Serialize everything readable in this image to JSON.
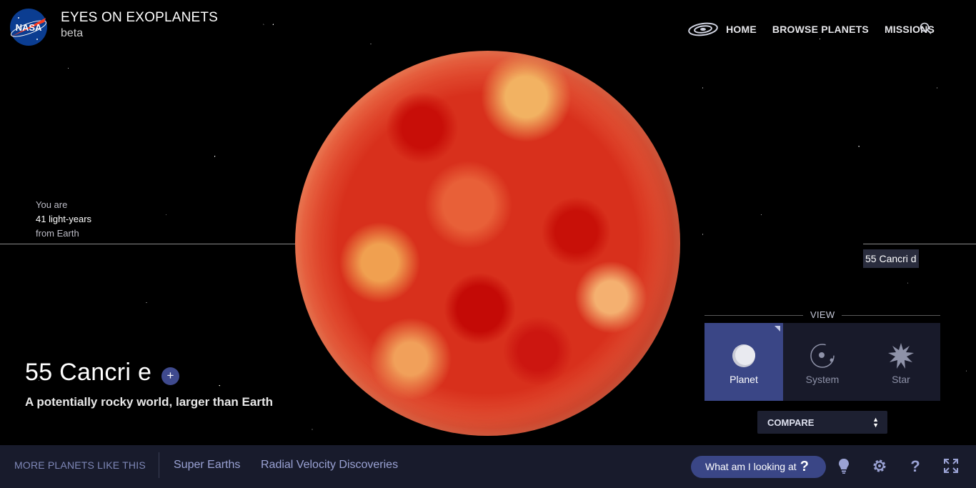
{
  "header": {
    "title": "EYES ON EXOPLANETS",
    "subtitle": "beta",
    "logo_text": "NASA",
    "nav": [
      "HOME",
      "BROWSE PLANETS",
      "MISSIONS"
    ]
  },
  "distance": {
    "line1": "You are",
    "line2": "41 light-years",
    "line3": "from Earth"
  },
  "planet": {
    "name": "55 Cancri e",
    "tagline": "A potentially rocky world, larger than Earth",
    "add_label": "+"
  },
  "neighbor_label": "55 Cancri d",
  "view": {
    "title": "VIEW",
    "options": [
      "Planet",
      "System",
      "Star"
    ],
    "selected": "Planet"
  },
  "compare": {
    "label": "COMPARE",
    "arrows": "▲▼"
  },
  "bottom": {
    "more_label": "MORE PLANETS LIKE THIS",
    "categories": [
      "Super Earths",
      "Radial Velocity Discoveries"
    ],
    "what_label": "What am I looking at",
    "what_q": "?"
  },
  "colors": {
    "accent": "#3a4686",
    "panel": "#181a2a",
    "bar": "#181b2c",
    "link": "#9aa2d4"
  }
}
